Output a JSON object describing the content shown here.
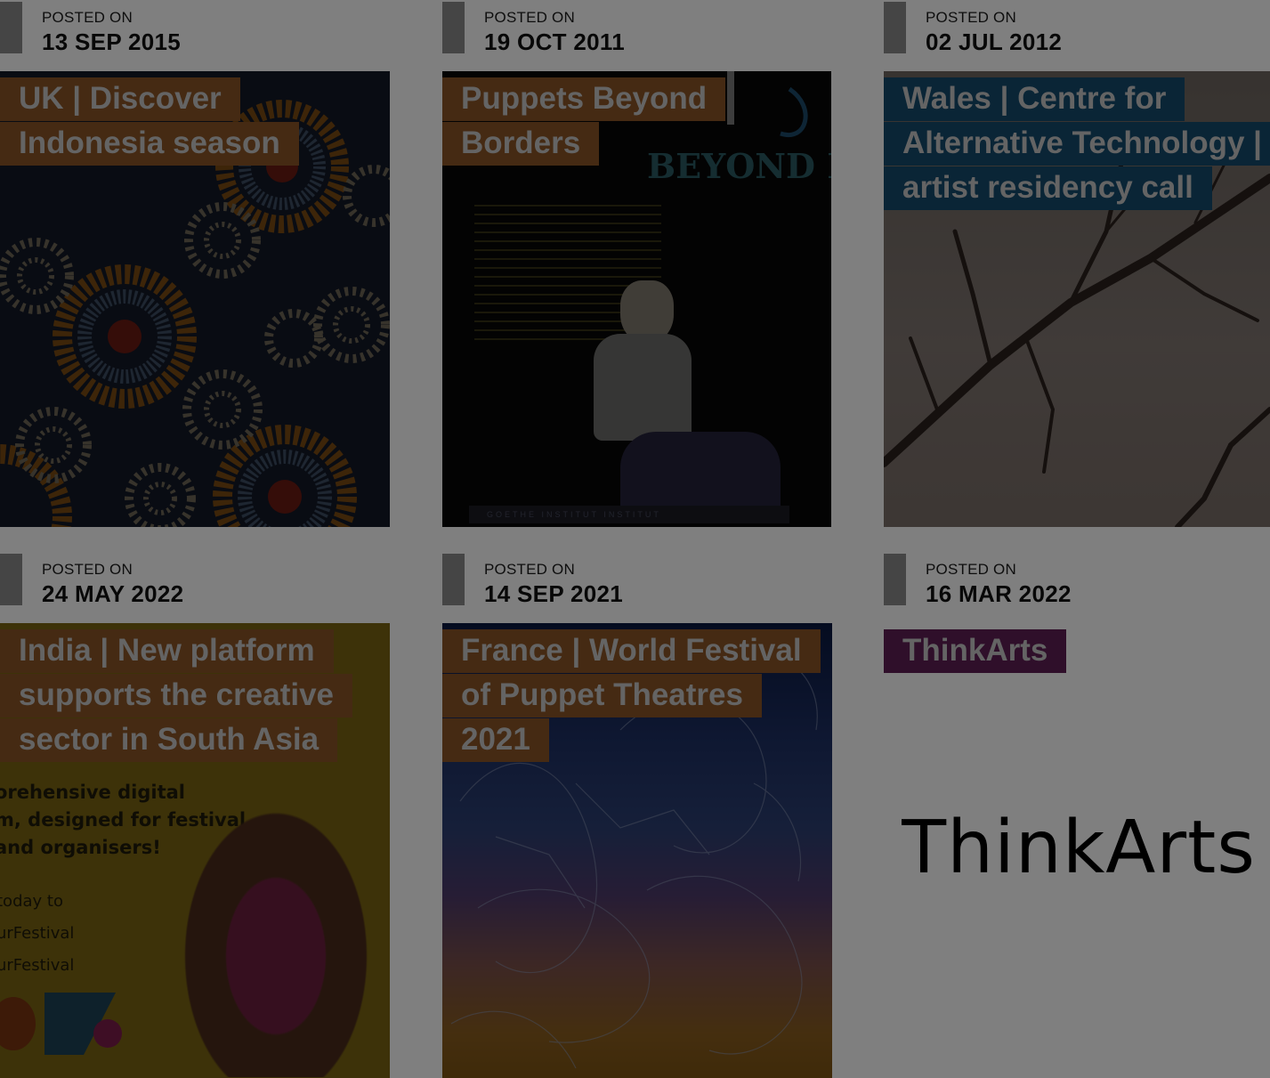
{
  "posts": [
    {
      "posted_label": "POSTED ON",
      "date": "13 SEP 2015",
      "title": "UK | Discover Indonesia season",
      "title_color": "#8a5527",
      "image": "batik-pattern"
    },
    {
      "posted_label": "POSTED ON",
      "date": "19 OCT 2011",
      "title": "Puppets Beyond Borders",
      "title_color": "#8a5527",
      "image": "puppet-poster"
    },
    {
      "posted_label": "POSTED ON",
      "date": "02 JUL 2012",
      "title": "Wales | Centre for Alternative Technology | artist residency call",
      "title_color": "#144b6c",
      "image": "tree-branches"
    },
    {
      "posted_label": "POSTED ON",
      "date": "24 MAY 2022",
      "title": "India | New platform supports the creative sector in South Asia",
      "title_color": "#8a5527",
      "image": "india-dancers"
    },
    {
      "posted_label": "POSTED ON",
      "date": "14 SEP 2021",
      "title": "France | World Festival of Puppet Theatres 2021",
      "title_color": "#8a5527",
      "image": "puppet-sketch"
    },
    {
      "posted_label": "POSTED ON",
      "date": "16 MAR 2022",
      "title": "ThinkArts",
      "title_color": "#5e1f55",
      "image": "thinkarts-logo"
    }
  ],
  "poster": {
    "brand_text": "BEYOND BORDERS",
    "footer_logos": "GOETHE INSTITUT INSTITUT"
  },
  "india_promo": {
    "line1": "orehensive digital",
    "line2": "m, designed for festival",
    "line3": "and organisers!",
    "line4": "today to",
    "line5": "urFestival",
    "line6": "urFestival"
  },
  "thinkarts_logo_text": "ThinkArts",
  "overlay": {
    "color": "#000000",
    "opacity": 0.5
  }
}
